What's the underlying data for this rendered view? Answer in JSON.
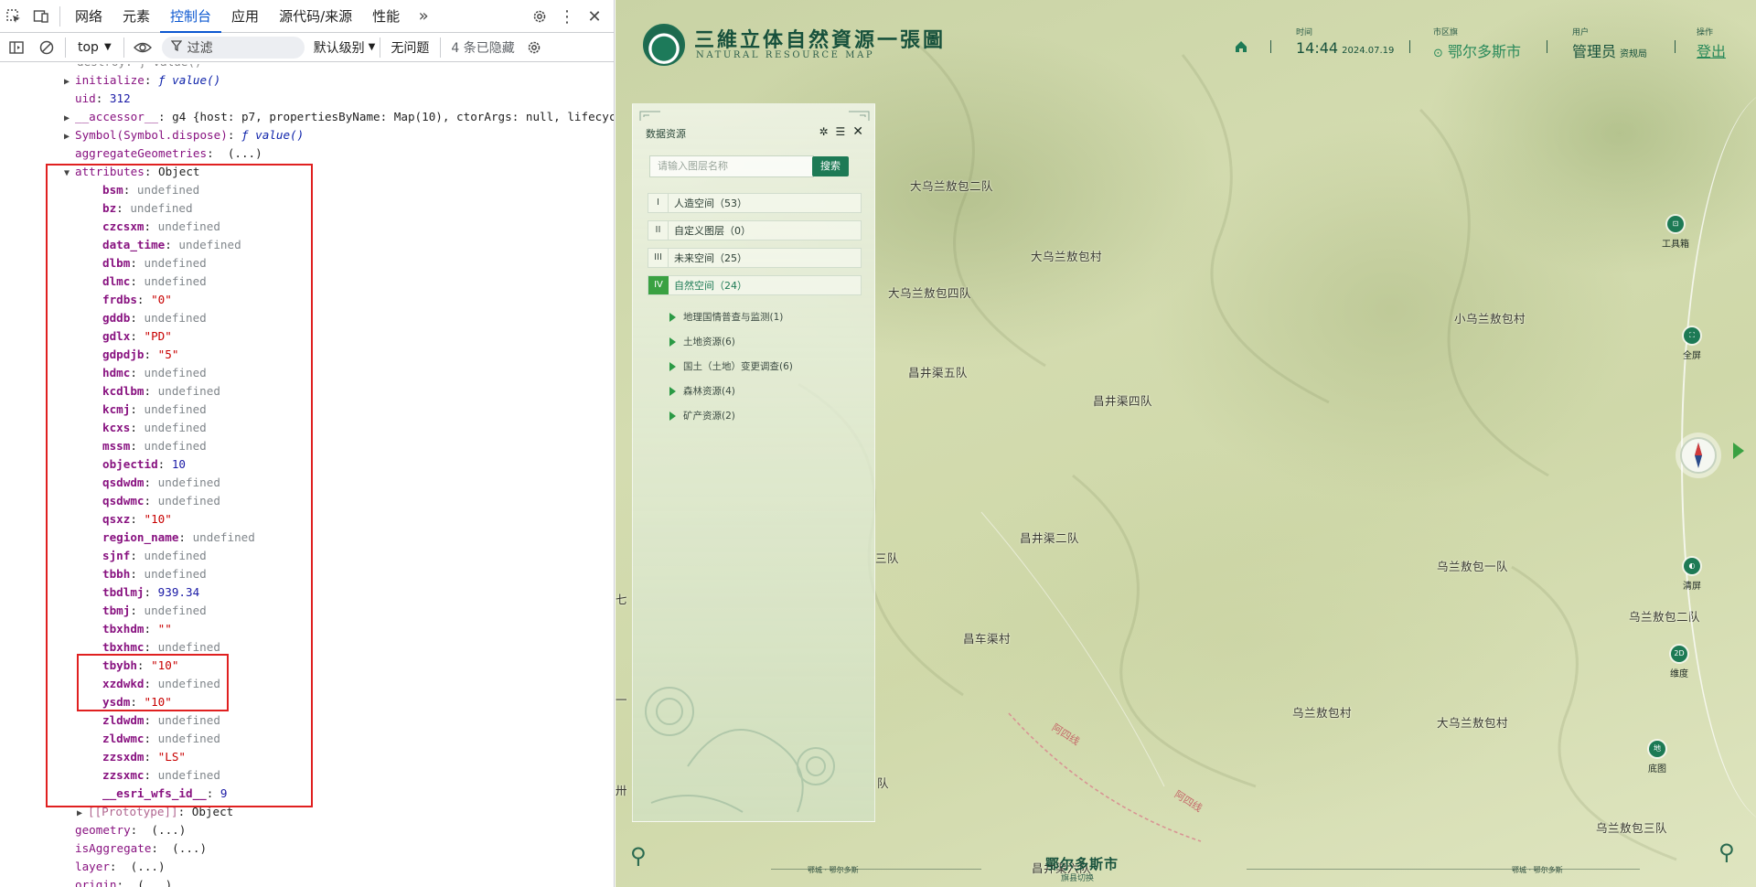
{
  "devtools": {
    "tabs": [
      "网络",
      "元素",
      "控制台",
      "应用",
      "源代码/来源",
      "性能"
    ],
    "active_tab": "控制台",
    "toolbar": {
      "context": "top",
      "filter_placeholder": "过滤",
      "level": "默认级别",
      "issues": "无问题",
      "hidden": "4 条已隐藏"
    },
    "lines": [
      {
        "indent": 2,
        "tri": "▶",
        "key": "initialize",
        "sep": ": ",
        "val": "ƒ value()",
        "vtype": "f",
        "kstyle": "k"
      },
      {
        "indent": 2,
        "tri": "",
        "key": "uid",
        "sep": ": ",
        "val": "312",
        "vtype": "n",
        "kstyle": "k"
      },
      {
        "indent": 2,
        "tri": "▶",
        "key": "__accessor__",
        "sep": ": ",
        "val": "g4 {host: p7, propertiesByName: Map(10), ctorArgs: null, lifecycle: 2, sto",
        "vtype": "",
        "kstyle": "k"
      },
      {
        "indent": 2,
        "tri": "▶",
        "key": "Symbol(Symbol.dispose)",
        "sep": ": ",
        "val": "ƒ value()",
        "vtype": "f",
        "kstyle": "k"
      },
      {
        "indent": 2,
        "tri": "",
        "key": "aggregateGeometries",
        "sep": ":  ",
        "val": "(...)",
        "vtype": "",
        "kstyle": "k"
      },
      {
        "indent": 2,
        "tri": "▼",
        "key": "attributes",
        "sep": ": ",
        "val": "Object",
        "vtype": "",
        "kstyle": "k"
      },
      {
        "indent": 4,
        "tri": "",
        "key": "bsm",
        "sep": ": ",
        "val": "undefined",
        "vtype": "u",
        "kstyle": "kb"
      },
      {
        "indent": 4,
        "tri": "",
        "key": "bz",
        "sep": ": ",
        "val": "undefined",
        "vtype": "u",
        "kstyle": "kb"
      },
      {
        "indent": 4,
        "tri": "",
        "key": "czcsxm",
        "sep": ": ",
        "val": "undefined",
        "vtype": "u",
        "kstyle": "kb"
      },
      {
        "indent": 4,
        "tri": "",
        "key": "data_time",
        "sep": ": ",
        "val": "undefined",
        "vtype": "u",
        "kstyle": "kb"
      },
      {
        "indent": 4,
        "tri": "",
        "key": "dlbm",
        "sep": ": ",
        "val": "undefined",
        "vtype": "u",
        "kstyle": "kb"
      },
      {
        "indent": 4,
        "tri": "",
        "key": "dlmc",
        "sep": ": ",
        "val": "undefined",
        "vtype": "u",
        "kstyle": "kb"
      },
      {
        "indent": 4,
        "tri": "",
        "key": "frdbs",
        "sep": ": ",
        "val": "\"0\"",
        "vtype": "s",
        "kstyle": "kb"
      },
      {
        "indent": 4,
        "tri": "",
        "key": "gddb",
        "sep": ": ",
        "val": "undefined",
        "vtype": "u",
        "kstyle": "kb"
      },
      {
        "indent": 4,
        "tri": "",
        "key": "gdlx",
        "sep": ": ",
        "val": "\"PD\"",
        "vtype": "s",
        "kstyle": "kb"
      },
      {
        "indent": 4,
        "tri": "",
        "key": "gdpdjb",
        "sep": ": ",
        "val": "\"5\"",
        "vtype": "s",
        "kstyle": "kb"
      },
      {
        "indent": 4,
        "tri": "",
        "key": "hdmc",
        "sep": ": ",
        "val": "undefined",
        "vtype": "u",
        "kstyle": "kb"
      },
      {
        "indent": 4,
        "tri": "",
        "key": "kcdlbm",
        "sep": ": ",
        "val": "undefined",
        "vtype": "u",
        "kstyle": "kb"
      },
      {
        "indent": 4,
        "tri": "",
        "key": "kcmj",
        "sep": ": ",
        "val": "undefined",
        "vtype": "u",
        "kstyle": "kb"
      },
      {
        "indent": 4,
        "tri": "",
        "key": "kcxs",
        "sep": ": ",
        "val": "undefined",
        "vtype": "u",
        "kstyle": "kb"
      },
      {
        "indent": 4,
        "tri": "",
        "key": "mssm",
        "sep": ": ",
        "val": "undefined",
        "vtype": "u",
        "kstyle": "kb"
      },
      {
        "indent": 4,
        "tri": "",
        "key": "objectid",
        "sep": ": ",
        "val": "10",
        "vtype": "n",
        "kstyle": "kb"
      },
      {
        "indent": 4,
        "tri": "",
        "key": "qsdwdm",
        "sep": ": ",
        "val": "undefined",
        "vtype": "u",
        "kstyle": "kb"
      },
      {
        "indent": 4,
        "tri": "",
        "key": "qsdwmc",
        "sep": ": ",
        "val": "undefined",
        "vtype": "u",
        "kstyle": "kb"
      },
      {
        "indent": 4,
        "tri": "",
        "key": "qsxz",
        "sep": ": ",
        "val": "\"10\"",
        "vtype": "s",
        "kstyle": "kb"
      },
      {
        "indent": 4,
        "tri": "",
        "key": "region_name",
        "sep": ": ",
        "val": "undefined",
        "vtype": "u",
        "kstyle": "kb"
      },
      {
        "indent": 4,
        "tri": "",
        "key": "sjnf",
        "sep": ": ",
        "val": "undefined",
        "vtype": "u",
        "kstyle": "kb"
      },
      {
        "indent": 4,
        "tri": "",
        "key": "tbbh",
        "sep": ": ",
        "val": "undefined",
        "vtype": "u",
        "kstyle": "kb"
      },
      {
        "indent": 4,
        "tri": "",
        "key": "tbdlmj",
        "sep": ": ",
        "val": "939.34",
        "vtype": "n",
        "kstyle": "kb"
      },
      {
        "indent": 4,
        "tri": "",
        "key": "tbmj",
        "sep": ": ",
        "val": "undefined",
        "vtype": "u",
        "kstyle": "kb"
      },
      {
        "indent": 4,
        "tri": "",
        "key": "tbxhdm",
        "sep": ": ",
        "val": "\"\"",
        "vtype": "s",
        "kstyle": "kb"
      },
      {
        "indent": 4,
        "tri": "",
        "key": "tbxhmc",
        "sep": ": ",
        "val": "undefined",
        "vtype": "u",
        "kstyle": "kb"
      },
      {
        "indent": 4,
        "tri": "",
        "key": "tbybh",
        "sep": ": ",
        "val": "\"10\"",
        "vtype": "s",
        "kstyle": "kb"
      },
      {
        "indent": 4,
        "tri": "",
        "key": "xzdwkd",
        "sep": ": ",
        "val": "undefined",
        "vtype": "u",
        "kstyle": "kb"
      },
      {
        "indent": 4,
        "tri": "",
        "key": "ysdm",
        "sep": ": ",
        "val": "\"10\"",
        "vtype": "s",
        "kstyle": "kb"
      },
      {
        "indent": 4,
        "tri": "",
        "key": "zldwdm",
        "sep": ": ",
        "val": "undefined",
        "vtype": "u",
        "kstyle": "kb"
      },
      {
        "indent": 4,
        "tri": "",
        "key": "zldwmc",
        "sep": ": ",
        "val": "undefined",
        "vtype": "u",
        "kstyle": "kb"
      },
      {
        "indent": 4,
        "tri": "",
        "key": "zzsxdm",
        "sep": ": ",
        "val": "\"LS\"",
        "vtype": "s",
        "kstyle": "kb"
      },
      {
        "indent": 4,
        "tri": "",
        "key": "zzsxmc",
        "sep": ": ",
        "val": "undefined",
        "vtype": "u",
        "kstyle": "kb"
      },
      {
        "indent": 4,
        "tri": "",
        "key": "__esri_wfs_id__",
        "sep": ": ",
        "val": "9",
        "vtype": "n",
        "kstyle": "kb"
      },
      {
        "indent": 3,
        "tri": "▶",
        "key": "[[Prototype]]",
        "sep": ": ",
        "val": "Object",
        "vtype": "",
        "kstyle": "ks"
      },
      {
        "indent": 2,
        "tri": "",
        "key": "geometry",
        "sep": ":  ",
        "val": "(...)",
        "vtype": "",
        "kstyle": "k"
      },
      {
        "indent": 2,
        "tri": "",
        "key": "isAggregate",
        "sep": ":  ",
        "val": "(...)",
        "vtype": "",
        "kstyle": "k"
      },
      {
        "indent": 2,
        "tri": "",
        "key": "layer",
        "sep": ":  ",
        "val": "(...)",
        "vtype": "",
        "kstyle": "k"
      },
      {
        "indent": 2,
        "tri": "",
        "key": "origin",
        "sep": ":  ",
        "val": "(...)",
        "vtype": "",
        "kstyle": "k"
      }
    ],
    "top_partial_line": "destroy: ƒ value()"
  },
  "map": {
    "title": "三維立体自然資源一張圖",
    "subtitle": "NATURAL RESOURCE MAP",
    "time_label": "时间",
    "time_value": "14:44",
    "date_value": "2024.07.19",
    "region_label": "市区旗",
    "region_value": "鄂尔多斯市",
    "user_label": "用户",
    "user_value": "管理员",
    "user_org": "资规局",
    "op_label": "操作",
    "logout": "登出",
    "panel": {
      "title": "数据资源",
      "search_placeholder": "请输入图层名称",
      "search_button": "搜索",
      "categories": [
        {
          "num": "I",
          "label": "人造空间（53）"
        },
        {
          "num": "II",
          "label": "自定义图层（0）"
        },
        {
          "num": "III",
          "label": "未来空间（25）"
        },
        {
          "num": "IV",
          "label": "自然空间（24）"
        }
      ],
      "sub_items": [
        "地理国情普查与监测(1)",
        "土地资源(6)",
        "国土（土地）变更调查(6)",
        "森林资源(4)",
        "矿产资源(2)"
      ]
    },
    "places": [
      "大乌兰敖包二队",
      "大乌兰敖包村",
      "大乌兰敖包四队",
      "昌井渠五队",
      "昌井渠四队",
      "小乌兰敖包村",
      "昌井渠二队",
      "乌兰敖包一队",
      "乌兰敖包二队",
      "昌车渠村",
      "乌兰敖包村",
      "大乌兰敖包村",
      "乌兰敖包三队",
      "昌井渠六队",
      "三队",
      "队",
      "七",
      "一",
      "卅"
    ],
    "roads": [
      "阿四线",
      "阿四线"
    ],
    "tools": [
      "工具箱",
      "全屏",
      "清屏",
      "维度",
      "底图"
    ],
    "tool_glyphs": [
      "⊡",
      "⛶",
      "◐",
      "2D",
      "地"
    ],
    "bottom_title": "鄂尔多斯市",
    "bottom_sub": "旗县切换",
    "bottom_left_small": "鄂城 · 鄂尔多斯",
    "bottom_right_small": "鄂城 · 鄂尔多斯"
  },
  "colors": {
    "accent_green": "#1d7a55",
    "active_green": "#3aa142",
    "devtools_blue": "#0b57d0",
    "annotation_red": "#e02020"
  }
}
